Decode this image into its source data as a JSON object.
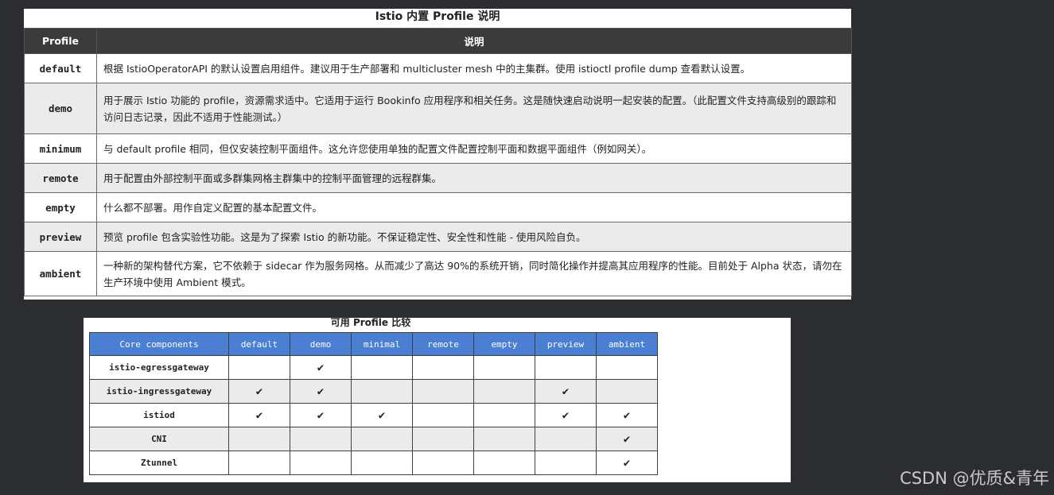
{
  "profiles_table": {
    "title": "Istio 内置 Profile 说明",
    "headers": [
      "Profile",
      "说明"
    ],
    "rows": [
      {
        "name": "default",
        "desc": "根据 IstioOperatorAPI 的默认设置启用组件。建议用于生产部署和 multicluster mesh 中的主集群。使用 istioctl profile dump 查看默认设置。"
      },
      {
        "name": "demo",
        "desc": "用于展示 Istio 功能的 profile，资源需求适中。它适用于运行 Bookinfo 应用程序和相关任务。这是随快速启动说明一起安装的配置。（此配置文件支持高级别的跟踪和访问日志记录，因此不适用于性能测试。）"
      },
      {
        "name": "minimum",
        "desc": "与 default profile 相同，但仅安装控制平面组件。这允许您使用单独的配置文件配置控制平面和数据平面组件（例如网关）。"
      },
      {
        "name": "remote",
        "desc": "用于配置由外部控制平面或多群集网格主群集中的控制平面管理的远程群集。"
      },
      {
        "name": "empty",
        "desc": "什么都不部署。用作自定义配置的基本配置文件。"
      },
      {
        "name": "preview",
        "desc": "预览 profile 包含实验性功能。这是为了探索 Istio 的新功能。不保证稳定性、安全性和性能 - 使用风险自负。"
      },
      {
        "name": "ambient",
        "desc": "一种新的架构替代方案，它不依赖于 sidecar 作为服务网格。从而减少了高达 90%的系统开销，同时简化操作并提高其应用程序的性能。目前处于 Alpha 状态，请勿在生产环境中使用 Ambient 模式。"
      }
    ]
  },
  "compare_table": {
    "title": "可用 Profile 比较",
    "headers": [
      "Core components",
      "default",
      "demo",
      "minimal",
      "remote",
      "empty",
      "preview",
      "ambient"
    ],
    "check_mark": "✔",
    "rows": [
      {
        "component": "istio-egressgateway",
        "cells": [
          "",
          "✔",
          "",
          "",
          "",
          "",
          ""
        ]
      },
      {
        "component": "istio-ingressgateway",
        "cells": [
          "✔",
          "✔",
          "",
          "",
          "",
          "✔",
          ""
        ]
      },
      {
        "component": "istiod",
        "cells": [
          "✔",
          "✔",
          "✔",
          "",
          "",
          "✔",
          "✔"
        ]
      },
      {
        "component": "CNI",
        "cells": [
          "",
          "",
          "",
          "",
          "",
          "",
          "✔"
        ]
      },
      {
        "component": "Ztunnel",
        "cells": [
          "",
          "",
          "",
          "",
          "",
          "",
          "✔"
        ]
      }
    ]
  },
  "watermark": "CSDN @优质&青年",
  "colors": {
    "background": "#2b2d30",
    "header_dark": "#3b3b3b",
    "header_blue": "#4a7fd3",
    "row_alt": "#ebebeb"
  }
}
